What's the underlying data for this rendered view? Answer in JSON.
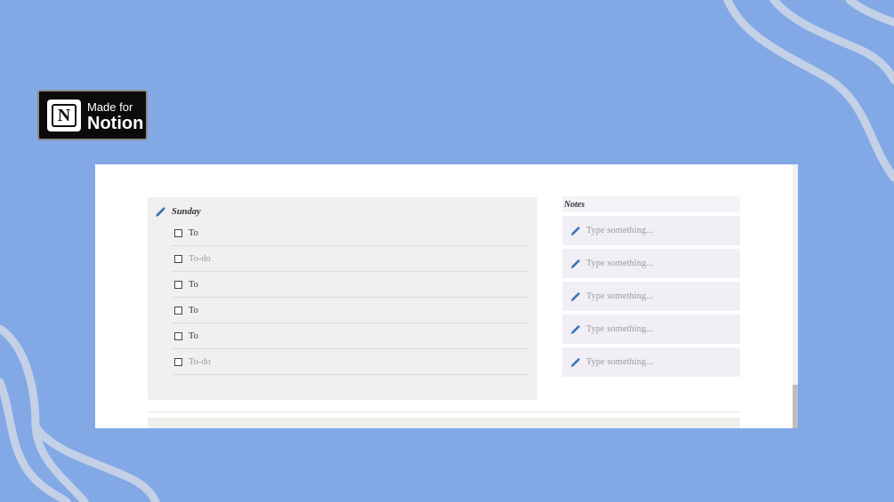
{
  "badge": {
    "logo_letter": "N",
    "made_for": "Made for",
    "brand": "Notion"
  },
  "planner": {
    "day_title": "Sunday",
    "todos": [
      {
        "label": "To",
        "placeholder": false,
        "checked": false
      },
      {
        "label": "To-do",
        "placeholder": true,
        "checked": false
      },
      {
        "label": "To",
        "placeholder": false,
        "checked": false
      },
      {
        "label": "To",
        "placeholder": false,
        "checked": false
      },
      {
        "label": "To",
        "placeholder": false,
        "checked": false
      },
      {
        "label": "To-do",
        "placeholder": true,
        "checked": false
      }
    ]
  },
  "notes": {
    "title": "Notes",
    "items": [
      {
        "placeholder": "Type something..."
      },
      {
        "placeholder": "Type something..."
      },
      {
        "placeholder": "Type something..."
      },
      {
        "placeholder": "Type something..."
      },
      {
        "placeholder": "Type something..."
      }
    ]
  },
  "colors": {
    "background": "#82a9e6",
    "wave": "#c3d0e6",
    "pencil": "#3f73b5"
  },
  "icons": {
    "pencil": "pencil-icon",
    "checkbox": "checkbox-icon"
  }
}
